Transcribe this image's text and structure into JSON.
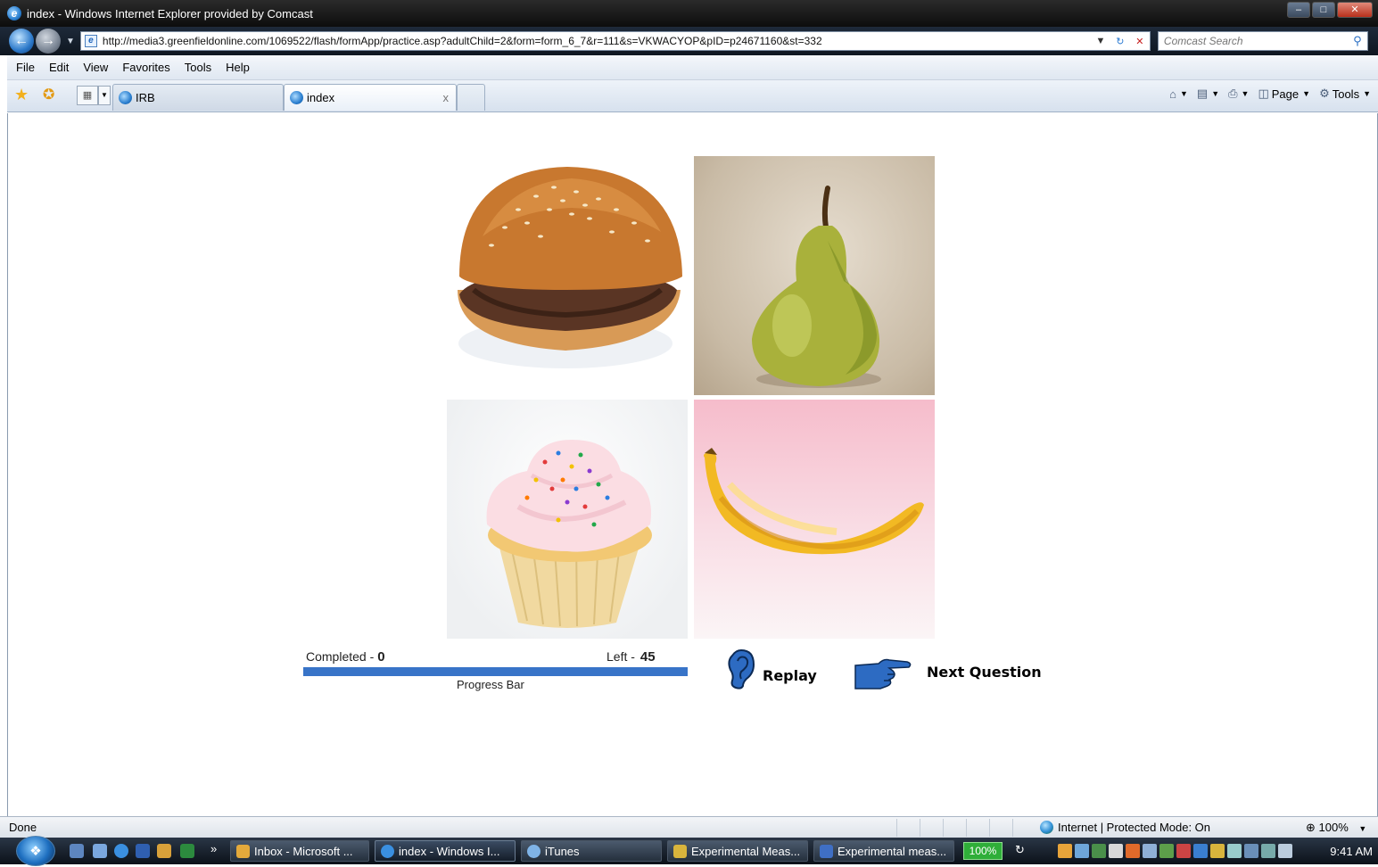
{
  "window": {
    "title": "index - Windows Internet Explorer provided by Comcast",
    "controls": [
      "minimize",
      "maximize",
      "close"
    ]
  },
  "addressbar": {
    "url": "http://media3.greenfieldonline.com/1069522/flash/formApp/practice.asp?adultChild=2&form=form_6_7&r=111&s=VKWACYOP&pID=p24671160&st=332",
    "search_placeholder": "Comcast Search"
  },
  "menu": {
    "items": [
      "File",
      "Edit",
      "View",
      "Favorites",
      "Tools",
      "Help"
    ]
  },
  "tabs": {
    "items": [
      {
        "label": "IRB",
        "active": false
      },
      {
        "label": "index",
        "active": true
      }
    ],
    "close_glyph": "x"
  },
  "commandbar": {
    "page_label": "Page",
    "tools_label": "Tools",
    "icons": [
      "home-icon",
      "feeds-icon",
      "print-icon",
      "page-icon",
      "tools-icon"
    ]
  },
  "survey": {
    "images": [
      "hamburger",
      "pear",
      "cupcake",
      "banana"
    ],
    "completed_label": "Completed -",
    "completed_value": "0",
    "left_label": "Left -",
    "left_value": "45",
    "progress_fraction": 0.0,
    "progress_caption": "Progress Bar",
    "replay_label": "Replay",
    "next_label": "Next Question",
    "accent_color": "#3874c8"
  },
  "status": {
    "text": "Done",
    "zone": "Internet | Protected Mode: On",
    "zoom": "100%"
  },
  "taskbar": {
    "overflow_glyph": "»",
    "buttons": [
      {
        "label": "Inbox - Microsoft ..."
      },
      {
        "label": "index - Windows I...",
        "active": true
      },
      {
        "label": "iTunes"
      },
      {
        "label": "Experimental Meas..."
      },
      {
        "label": "Experimental meas..."
      }
    ],
    "battery": "100%",
    "clock": "9:41 AM"
  }
}
